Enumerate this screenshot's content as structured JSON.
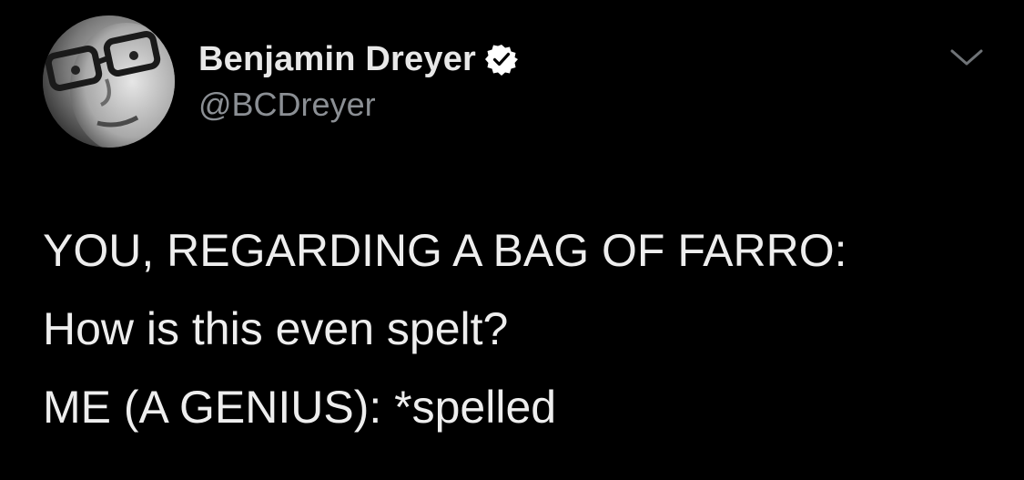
{
  "author": {
    "display_name": "Benjamin Dreyer",
    "handle": "@BCDreyer",
    "verified": true,
    "avatar_icon": "avatar-photo"
  },
  "menu": {
    "icon": "chevron-down-icon"
  },
  "tweet": {
    "lines": [
      "YOU, REGARDING A BAG OF FARRO:",
      "How is this even spelt?",
      "ME (A GENIUS): *spelled"
    ]
  },
  "colors": {
    "background": "#000000",
    "name_text": "#e8e8e8",
    "handle_text": "#8b8f94",
    "body_text": "#eeeeee",
    "verified_badge": "#ffffff"
  }
}
